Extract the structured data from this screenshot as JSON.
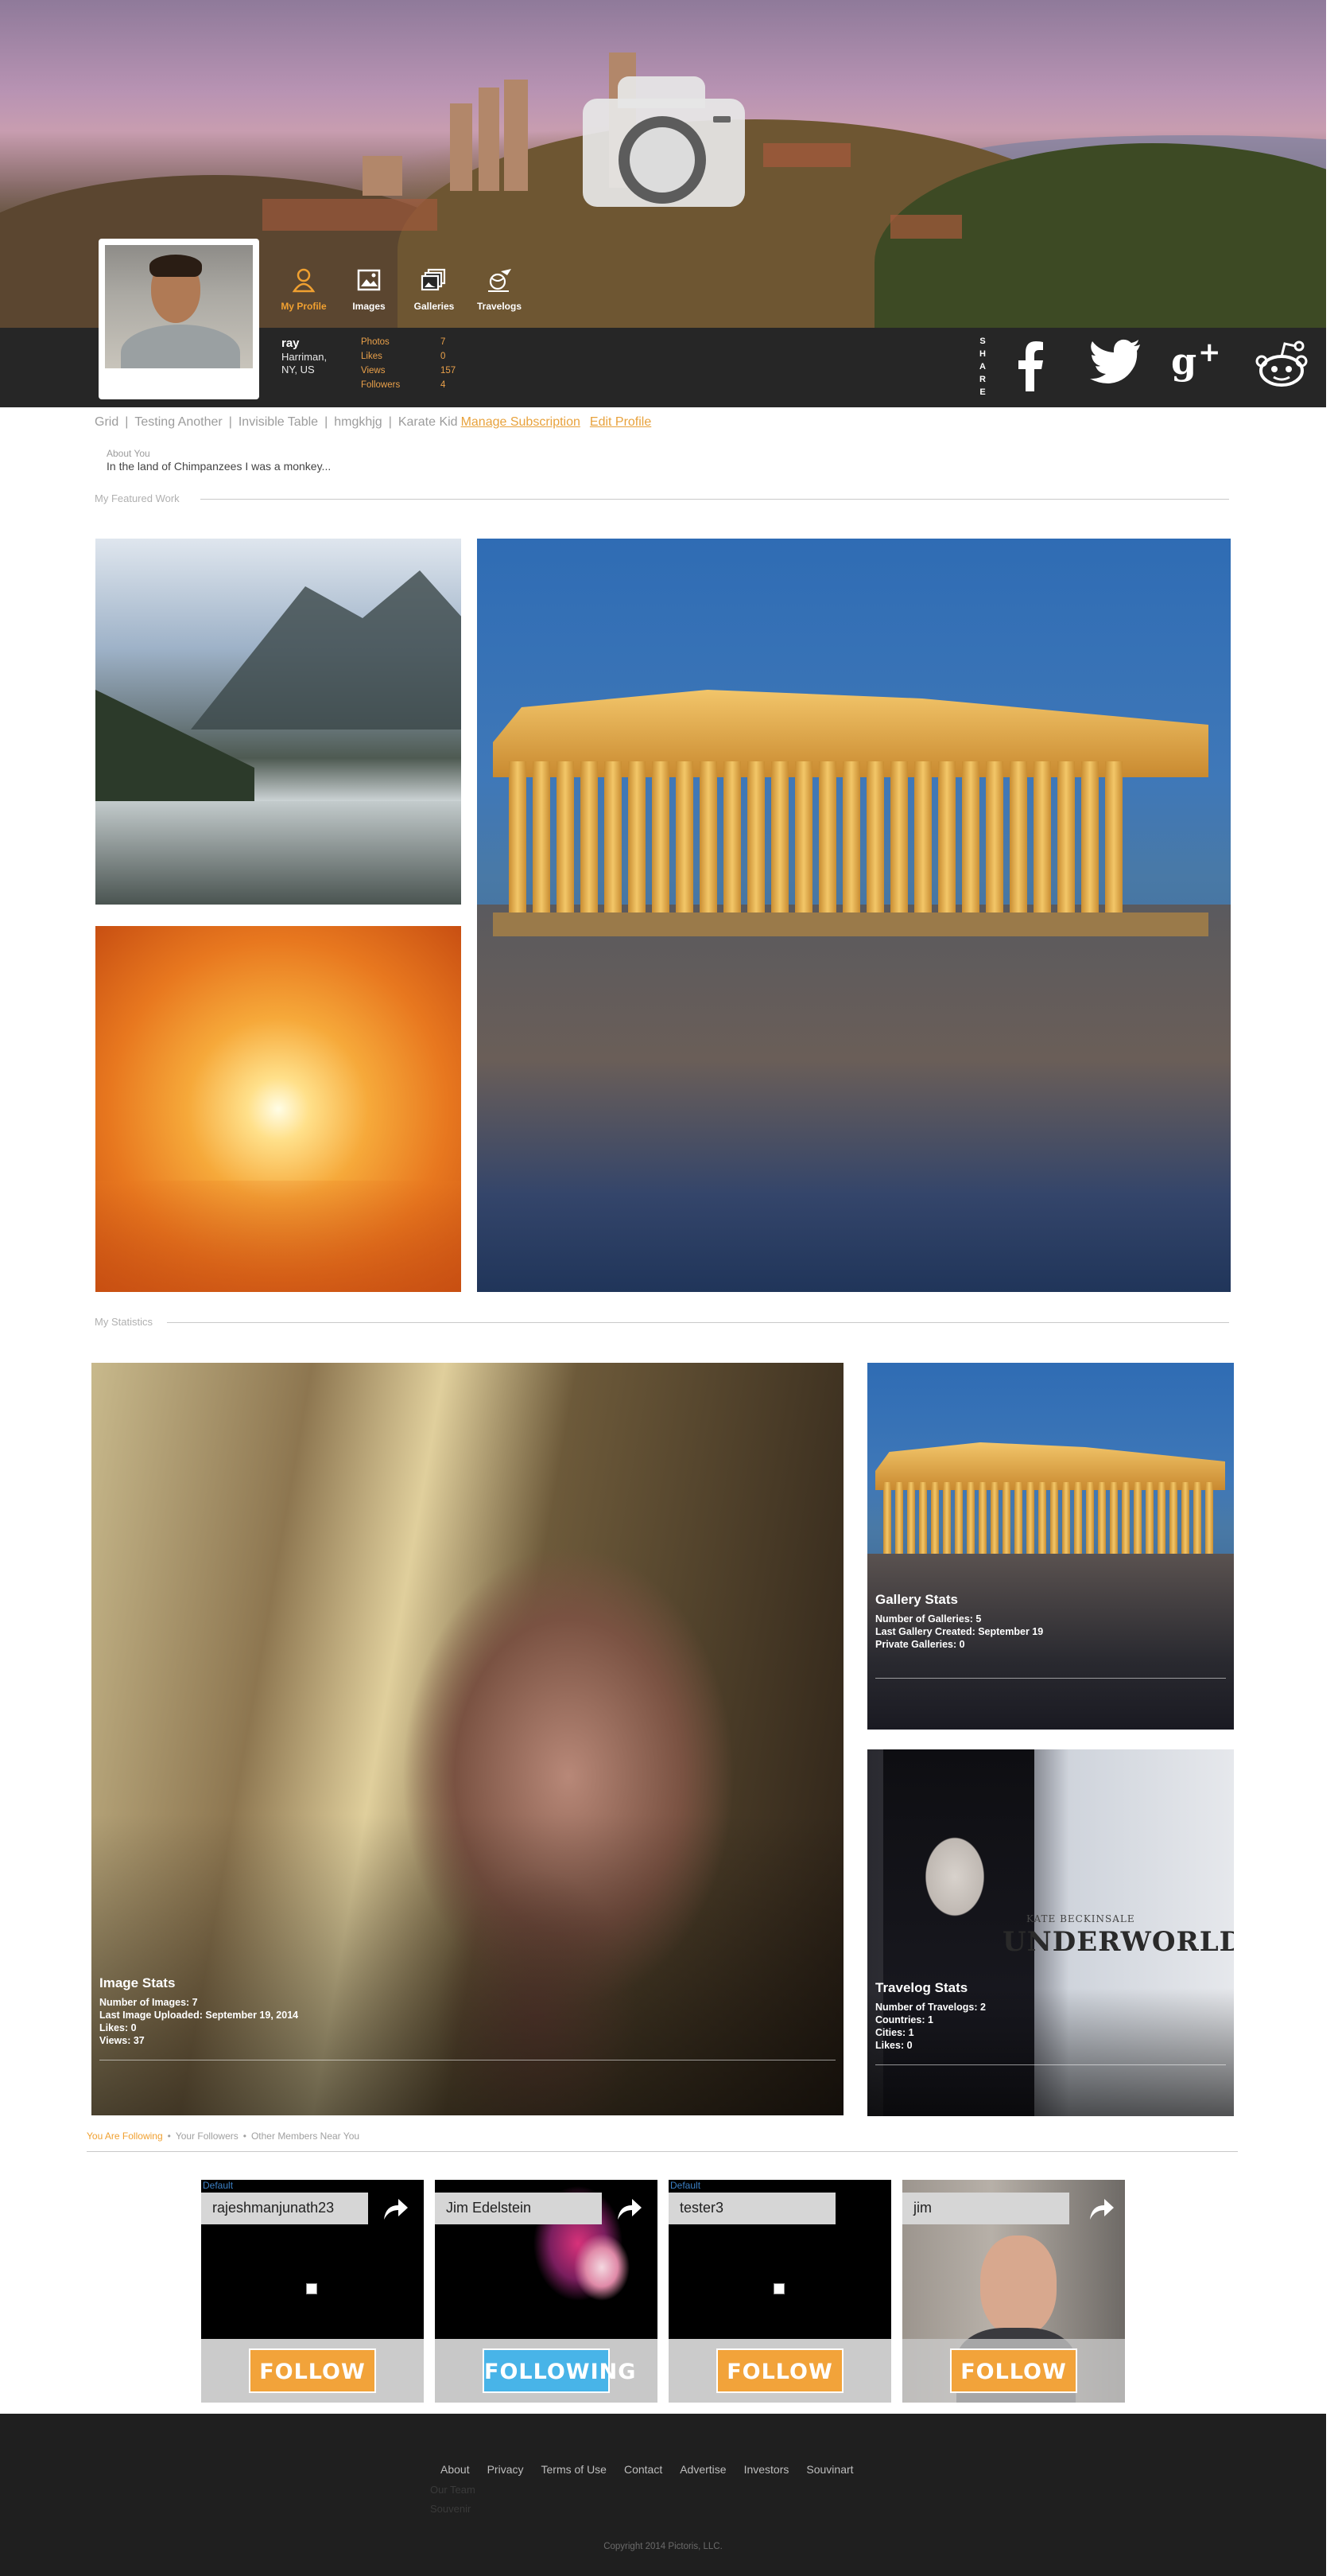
{
  "hero": {
    "camera_icon": "camera-icon"
  },
  "profile": {
    "name": "ray",
    "location_line1": "Harriman,",
    "location_line2": "NY, US"
  },
  "tabs": [
    {
      "label": "My Profile",
      "icon": "person-icon",
      "active": true
    },
    {
      "label": "Images",
      "icon": "image-icon",
      "active": false
    },
    {
      "label": "Galleries",
      "icon": "galleries-icon",
      "active": false
    },
    {
      "label": "Travelogs",
      "icon": "travelog-icon",
      "active": false
    }
  ],
  "stats": [
    {
      "label": "Photos",
      "value": "7"
    },
    {
      "label": "Likes",
      "value": "0"
    },
    {
      "label": "Views",
      "value": "157"
    },
    {
      "label": "Followers",
      "value": "4"
    }
  ],
  "share": {
    "label": "SHARE",
    "letters": [
      "S",
      "H",
      "A",
      "R",
      "E"
    ]
  },
  "social": [
    "facebook-icon",
    "twitter-icon",
    "google-plus-icon",
    "reddit-icon"
  ],
  "breadcrumbs": {
    "items": [
      "Grid",
      "Testing Another",
      "Invisible Table",
      "hmgkhjg",
      "Karate Kid"
    ],
    "separator": "|",
    "manage_subscription": "Manage Subscription",
    "edit_profile": "Edit Profile"
  },
  "about": {
    "label": "About You",
    "text": "In the land of Chimpanzees I was a monkey..."
  },
  "sections": {
    "featured": "My Featured Work",
    "statistics": "My Statistics"
  },
  "image_stats": {
    "title": "Image Stats",
    "lines": [
      "Number of Images: 7",
      "Last Image Uploaded: September 19, 2014",
      "Likes: 0",
      "Views: 37"
    ]
  },
  "gallery_stats": {
    "title": "Gallery Stats",
    "lines": [
      "Number of Galleries: 5",
      "Last Gallery Created: September 19",
      "Private Galleries: 0"
    ]
  },
  "travelog_stats": {
    "title": "Travelog Stats",
    "lines": [
      "Number of Travelogs: 2",
      "Countries: 1",
      "Cities: 1",
      "Likes: 0"
    ],
    "poster_title": "UNDERWORLD",
    "poster_sub": "KATE BECKINSALE"
  },
  "follow_tabs": {
    "following": "You Are Following",
    "followers": "Your Followers",
    "near": "Other Members Near You",
    "dot": "•"
  },
  "members": [
    {
      "name": "rajeshmanjunath23",
      "tag": "Default",
      "button": "FOLLOW",
      "state": "follow"
    },
    {
      "name": "Jim Edelstein",
      "tag": "",
      "button": "FOLLOWING",
      "state": "following"
    },
    {
      "name": "tester3",
      "tag": "Default",
      "button": "FOLLOW",
      "state": "follow"
    },
    {
      "name": "jim",
      "tag": "",
      "button": "FOLLOW",
      "state": "follow"
    }
  ],
  "footer": {
    "nav": [
      "About",
      "Privacy",
      "Terms of Use",
      "Contact",
      "Advertise",
      "Investors",
      "Souvinart"
    ],
    "sub": [
      "Our Team",
      "Souvenir"
    ],
    "copyright": "Copyright 2014 Pictoris, LLC."
  },
  "colors": {
    "accent": "#f0a030",
    "following": "#48b4e8",
    "bar": "#262626",
    "footer": "#1f1f1f"
  }
}
